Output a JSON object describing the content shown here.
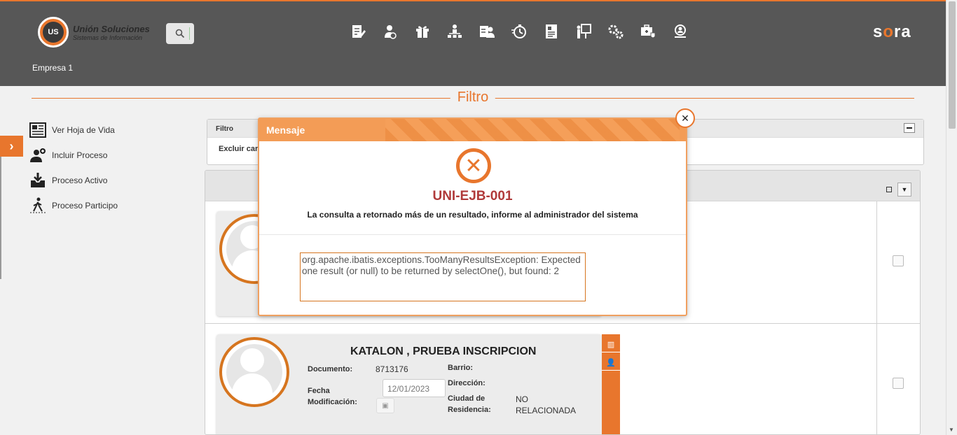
{
  "header": {
    "logo_badge": "US",
    "logo_line1": "Unión Soluciones",
    "logo_line2": "Sistemas de Información",
    "company": "Empresa 1",
    "brand_prefix": "s",
    "brand_o": "o",
    "brand_suffix": "ra",
    "nav_icons": [
      "document-edit-icon",
      "person-money-icon",
      "gift-icon",
      "org-chart-icon",
      "id-card-icon",
      "stopwatch-icon",
      "resume-icon",
      "presentation-icon",
      "gears-icon",
      "medical-kit-icon",
      "search-people-icon"
    ]
  },
  "filtro": {
    "title": "Filtro"
  },
  "sidemenu": {
    "items": [
      {
        "label": "Ver Hoja de Vida",
        "icon": "newspaper-icon"
      },
      {
        "label": "Incluir Proceso",
        "icon": "add-user-icon"
      },
      {
        "label": "Proceso Activo",
        "icon": "inbox-download-icon"
      },
      {
        "label": "Proceso Participo",
        "icon": "walking-person-icon"
      }
    ]
  },
  "filter_panel": {
    "header": "Filtro",
    "body": "Excluir car"
  },
  "card": {
    "name": "KATALON , PRUEBA INSCRIPCION",
    "documento_label": "Documento:",
    "documento_value": "8713176",
    "fecha_label_1": "Fecha",
    "fecha_label_2": "Modificación:",
    "fecha_value": "12/01/2023",
    "barrio_label": "Barrio:",
    "direccion_label": "Dirección:",
    "ciudad_label_1": "Ciudad de",
    "ciudad_label_2": "Residencia:",
    "ciudad_value_1": "NO",
    "ciudad_value_2": "RELACIONADA"
  },
  "modal": {
    "title": "Mensaje",
    "code": "UNI-EJB-001",
    "message": "La consulta a retornado más de un resultado, informe al administrador del sistema",
    "detail": "org.apache.ibatis.exceptions.TooManyResultsException: Expected one result (or null) to be returned by selectOne(), but found: 2"
  }
}
